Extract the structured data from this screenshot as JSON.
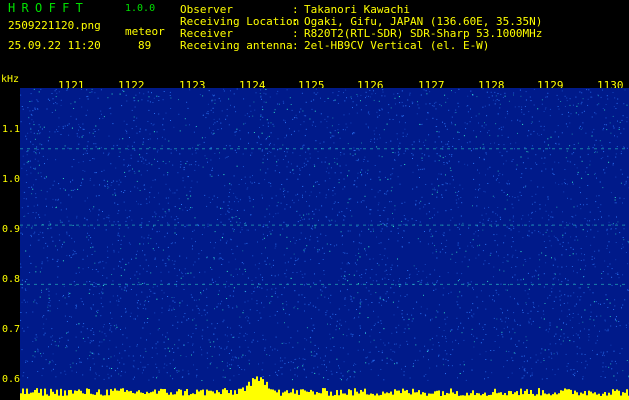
{
  "app": {
    "name": "HROFFT",
    "version": "1.0.0"
  },
  "file": {
    "name": "2509221120.png",
    "datetime": "25.09.22 11:20"
  },
  "detection": {
    "mode": "meteor",
    "count": "89"
  },
  "info": [
    {
      "label": "Observer",
      "value": "Takanori Kawachi"
    },
    {
      "label": "Receiving Location",
      "value": "Ogaki, Gifu, JAPAN (136.60E, 35.35N)"
    },
    {
      "label": "Receiver",
      "value": "R820T2(RTL-SDR) SDR-Sharp 53.1000MHz"
    },
    {
      "label": "Receiving antenna",
      "value": "2el-HB9CV Vertical (el. E-W)"
    }
  ],
  "chart_data": {
    "type": "heatmap",
    "y_unit": "kHz",
    "x_ticks": [
      "1121",
      "1122",
      "1123",
      "1124",
      "1125",
      "1126",
      "1127",
      "1128",
      "1129",
      "1130"
    ],
    "y_ticks": [
      "1.1",
      "1.0",
      "0.9",
      "0.8",
      "0.7",
      "0.6"
    ],
    "xlim": [
      1120.7,
      1130.7
    ],
    "ylim": [
      0.58,
      1.16
    ],
    "colors": {
      "background": "#001a8a",
      "noise": "#2f7cff",
      "signal": "#39ffd0",
      "strong": "#ff4040",
      "histogram": "#ffff00",
      "header_text": "#ffff00",
      "title_text": "#00e000"
    }
  }
}
